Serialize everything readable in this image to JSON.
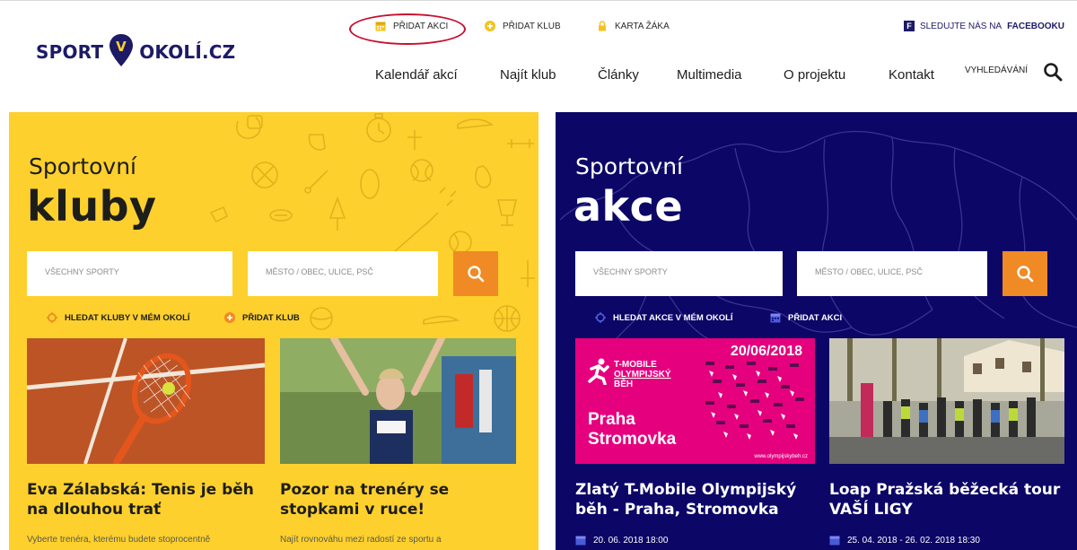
{
  "header": {
    "logo": {
      "part1": "SPORT",
      "pin_letter": "V",
      "part2": "OKOLÍ.CZ"
    },
    "top_links": [
      {
        "label": "PŘIDAT AKCI",
        "icon": "calendar-icon"
      },
      {
        "label": "PŘIDAT KLUB",
        "icon": "plus-circle-icon"
      },
      {
        "label": "KARTA ŽÁKA",
        "icon": "lock-icon"
      }
    ],
    "facebook": {
      "prefix": "SLEDUJTE NÁS NA",
      "brand": "FACEBOOKU",
      "icon_letter": "f"
    },
    "nav": [
      "Kalendář akcí",
      "Najít klub",
      "Články",
      "Multimedia",
      "O projektu",
      "Kontakt"
    ],
    "search_label": "VYHLEDÁVÁNÍ"
  },
  "clubs": {
    "title_small": "Sportovní",
    "title_big": "kluby",
    "sport_placeholder": "VŠECHNY SPORTY",
    "location_placeholder": "MĚSTO / OBEC, ULICE, PSČ",
    "link_nearby": "HLEDAT KLUBY V MÉM OKOLÍ",
    "link_add": "PŘIDAT KLUB",
    "articles": [
      {
        "title_line1": "Eva Zálabská: Tenis je běh",
        "title_line2": "na dlouhou trať",
        "excerpt": "Vyberte trenéra, kterému budete stoprocentně"
      },
      {
        "title_line1": "Pozor na trenéry se",
        "title_line2": "stopkami v ruce!",
        "excerpt": "Najít rovnováhu mezi radostí ze sportu a"
      }
    ]
  },
  "events": {
    "title_small": "Sportovní",
    "title_big": "akce",
    "sport_placeholder": "VŠECHNY SPORTY",
    "location_placeholder": "MĚSTO / OBEC, ULICE, PSČ",
    "link_nearby": "HLEDAT AKCE V MÉM OKOLÍ",
    "link_add": "PŘIDAT AKCI",
    "poster": {
      "date": "20/06/2018",
      "brand_line1": "T-MOBILE",
      "brand_line2": "OLYMPIJSKÝ",
      "brand_line3": "BĚH",
      "city": "Praha",
      "place": "Stromovka",
      "url": "www.olympijskybeh.cz"
    },
    "items": [
      {
        "title_line1": "Zlatý T-Mobile Olympijský",
        "title_line2": "běh - Praha, Stromovka",
        "date": "20. 06. 2018 18:00"
      },
      {
        "title_line1": "Loap Pražská běžecká tour",
        "title_line2": "VAŠÍ LIGY",
        "date": "25. 04. 2018 - 26. 02. 2018 18:30"
      }
    ]
  },
  "colors": {
    "brand": "#1d1a66",
    "yellow": "#fdd02d",
    "orange": "#f08a24",
    "blue_panel": "#0c0667",
    "poster_pink": "#e5007e",
    "highlight_oval": "#c8102e"
  }
}
